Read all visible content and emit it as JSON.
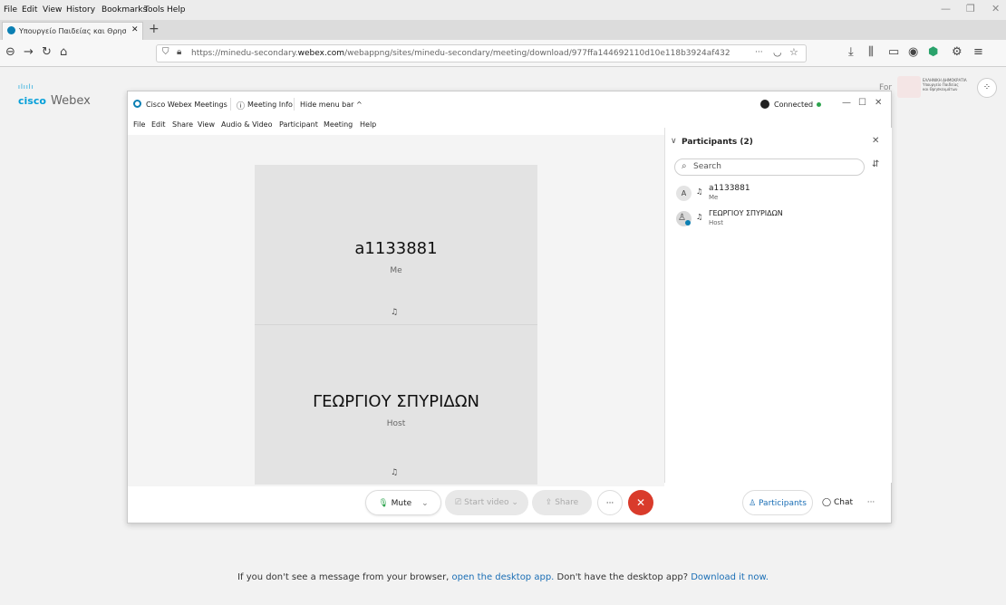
{
  "browser": {
    "menu": [
      "File",
      "Edit",
      "View",
      "History",
      "Bookmarks",
      "Tools",
      "Help"
    ],
    "tab_title": "Υπουργείο Παιδείας και Θρησκ",
    "url_prefix": "https://minedu-secondary.",
    "url_domain": "webex.com",
    "url_suffix": "/webappng/sites/minedu-secondary/meeting/download/977ffa144692110d10e118b3924af432",
    "url_more": "···",
    "new_tab": "+"
  },
  "page": {
    "brand_small": "cisco",
    "brand_name": "Webex",
    "for_label": "For",
    "ministry_line1": "ΕΛΛΗΝΙΚΗ ΔΗΜΟΚΡΑΤΙΑ",
    "ministry_line2": "Υπουργείο Παιδείας",
    "ministry_line3": "και Θρησκευμάτων",
    "footer_text1": "If you don't see a message from your browser,",
    "footer_link1": "open the desktop app.",
    "footer_text2": "Don't have the desktop app?",
    "footer_link2": "Download it now."
  },
  "webex": {
    "app_name": "Cisco Webex Meetings",
    "meeting_info": "Meeting Info",
    "hide_menu": "Hide menu bar ^",
    "status": "Connected",
    "status_color": "#2da44e",
    "menu": [
      "File",
      "Edit",
      "Share",
      "View",
      "Audio & Video",
      "Participant",
      "Meeting",
      "Help"
    ],
    "tiles": [
      {
        "name": "a1133881",
        "role": "Me"
      },
      {
        "name": "ΓΕΩΡΓΙΟΥ ΣΠΥΡΙΔΩΝ",
        "role": "Host"
      }
    ],
    "participants_panel": {
      "title": "Participants (2)",
      "search_placeholder": "Search",
      "items": [
        {
          "avatar": "A",
          "name": "a1133881",
          "role": "Me"
        },
        {
          "avatar": "",
          "name": "ΓΕΩΡΓΙΟΥ ΣΠΥΡΙΔΩΝ",
          "role": "Host"
        }
      ]
    },
    "controls": {
      "mute": "Mute",
      "start_video": "Start video",
      "share": "Share",
      "more": "···",
      "participants": "Participants",
      "chat": "Chat",
      "end_color": "#d93b2b"
    }
  }
}
